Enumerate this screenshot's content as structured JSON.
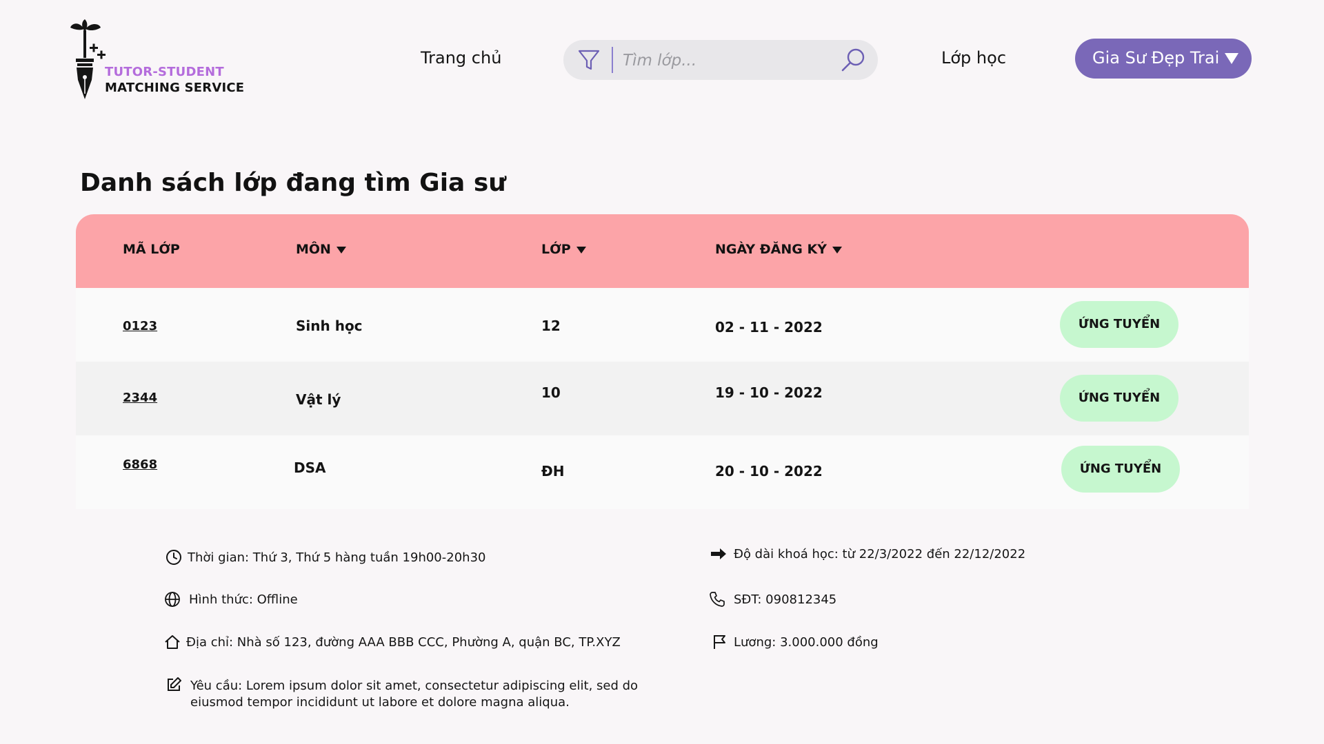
{
  "header": {
    "logo": {
      "line1": "TUTOR-STUDENT",
      "line2": "MATCHING SERVICE",
      "accent_color": "#b46cdc",
      "icon": "fountain-pen-sprout-logo"
    },
    "nav": {
      "home_label": "Trang chủ",
      "classes_label": "Lớp học"
    },
    "search": {
      "placeholder": "Tìm lớp...",
      "value": "",
      "filter_icon": "filter-icon",
      "search_icon": "search-icon"
    },
    "user_menu": {
      "name": "Gia Sư Đẹp Trai",
      "color": "#7a68b8",
      "caret_icon": "caret-down-icon"
    }
  },
  "page": {
    "title": "Danh sách lớp đang tìm Gia sư"
  },
  "table": {
    "header_color": "#fca4a8",
    "columns": [
      {
        "label": "MÃ LỚP",
        "sortable": false
      },
      {
        "label": "MÔN",
        "sortable": true
      },
      {
        "label": "LỚP",
        "sortable": true
      },
      {
        "label": "NGÀY ĐĂNG KÝ",
        "sortable": true
      }
    ],
    "rows": [
      {
        "id": "0123",
        "subject": "Sinh học",
        "grade": "12",
        "date": "02 - 11 - 2022",
        "action": "ỨNG TUYỂN"
      },
      {
        "id": "2344",
        "subject": "Vật lý",
        "grade": "10",
        "date": "19 -  10 - 2022",
        "action": "ỨNG TUYỂN"
      },
      {
        "id": "6868",
        "subject": "DSA",
        "grade": "ĐH",
        "date": "20 -  10 - 2022",
        "action": "ỨNG TUYỂN"
      }
    ],
    "action_color": "#c6f7cf"
  },
  "details": {
    "time": {
      "icon": "clock-icon",
      "text": "Thời gian: Thứ 3, Thứ 5 hàng tuần 19h00-20h30"
    },
    "format": {
      "icon": "globe-icon",
      "text": "Hình thức: Offline"
    },
    "address": {
      "icon": "home-icon",
      "text": "Địa chỉ: Nhà số 123, đường AAA BBB CCC, Phường A, quận BC, TP.XYZ"
    },
    "requirement": {
      "icon": "edit-icon",
      "text": "Yêu cầu: Lorem ipsum dolor sit amet, consectetur adipiscing elit, sed do eiusmod tempor incididunt ut labore et dolore magna aliqua."
    },
    "duration": {
      "icon": "arrow-right-icon",
      "text": "Độ dài khoá học: từ 22/3/2022 đến 22/12/2022"
    },
    "phone": {
      "icon": "phone-icon",
      "text": "SĐT: 090812345"
    },
    "salary": {
      "icon": "flag-icon",
      "text": "Lương: 3.000.000 đồng"
    }
  }
}
